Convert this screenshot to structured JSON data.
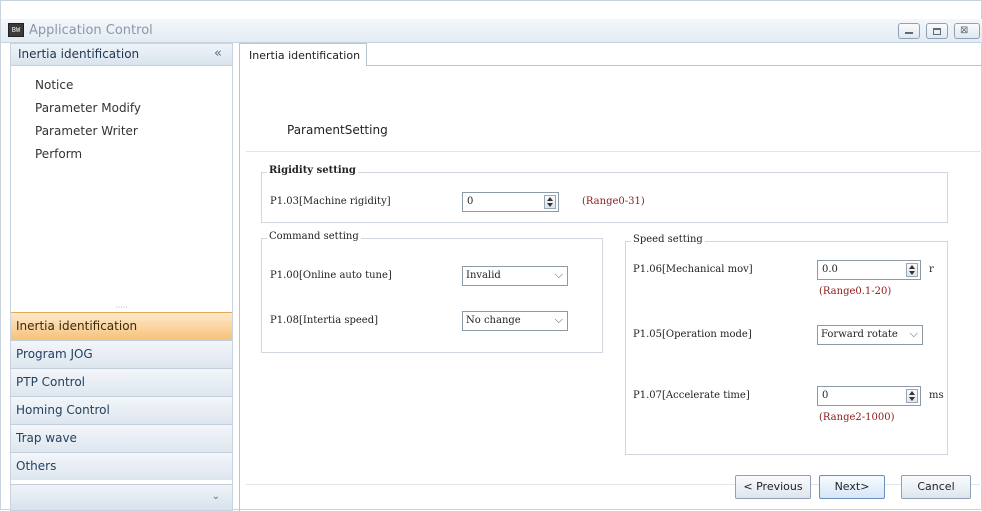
{
  "window": {
    "title": "Application Control",
    "icon_label": "BW"
  },
  "sidebar": {
    "header": "Inertia identification",
    "collapse_glyph": "«",
    "tree_items": [
      "Notice",
      "Parameter Modify",
      "Parameter Writer",
      "Perform"
    ],
    "splitter_glyph": "·····",
    "nav_items": [
      {
        "label": "Inertia identification",
        "active": true
      },
      {
        "label": "Program JOG",
        "active": false
      },
      {
        "label": "PTP Control",
        "active": false
      },
      {
        "label": "Homing Control",
        "active": false
      },
      {
        "label": "Trap wave",
        "active": false
      },
      {
        "label": "Others",
        "active": false
      }
    ],
    "chevron": "⌄"
  },
  "tab": {
    "label": "Inertia identification"
  },
  "page": {
    "title": "ParamentSetting"
  },
  "rigidity": {
    "legend": "Rigidity setting",
    "p103_label": "P1.03[Machine rigidity]",
    "p103_value": "0",
    "p103_range": "(Range0-31)"
  },
  "command": {
    "legend": "Command setting",
    "p100_label": "P1.00[Online auto tune]",
    "p100_value": "Invalid",
    "p108_label": "P1.08[Intertia speed]",
    "p108_value": "No change"
  },
  "speed": {
    "legend": "Speed setting",
    "p106_label": "P1.06[Mechanical mov]",
    "p106_value": "0.0",
    "p106_unit": "r",
    "p106_range": "(Range0.1-20)",
    "p105_label": "P1.05[Operation mode]",
    "p105_value": "Forward rotate",
    "p107_label": "P1.07[Accelerate time]",
    "p107_value": "0",
    "p107_unit": "ms",
    "p107_range": "(Range2-1000)"
  },
  "buttons": {
    "previous": "< Previous",
    "next": "Next>",
    "cancel": "Cancel"
  },
  "colors": {
    "active_nav": "#f7c27a",
    "range_text": "#8b1a1a"
  }
}
